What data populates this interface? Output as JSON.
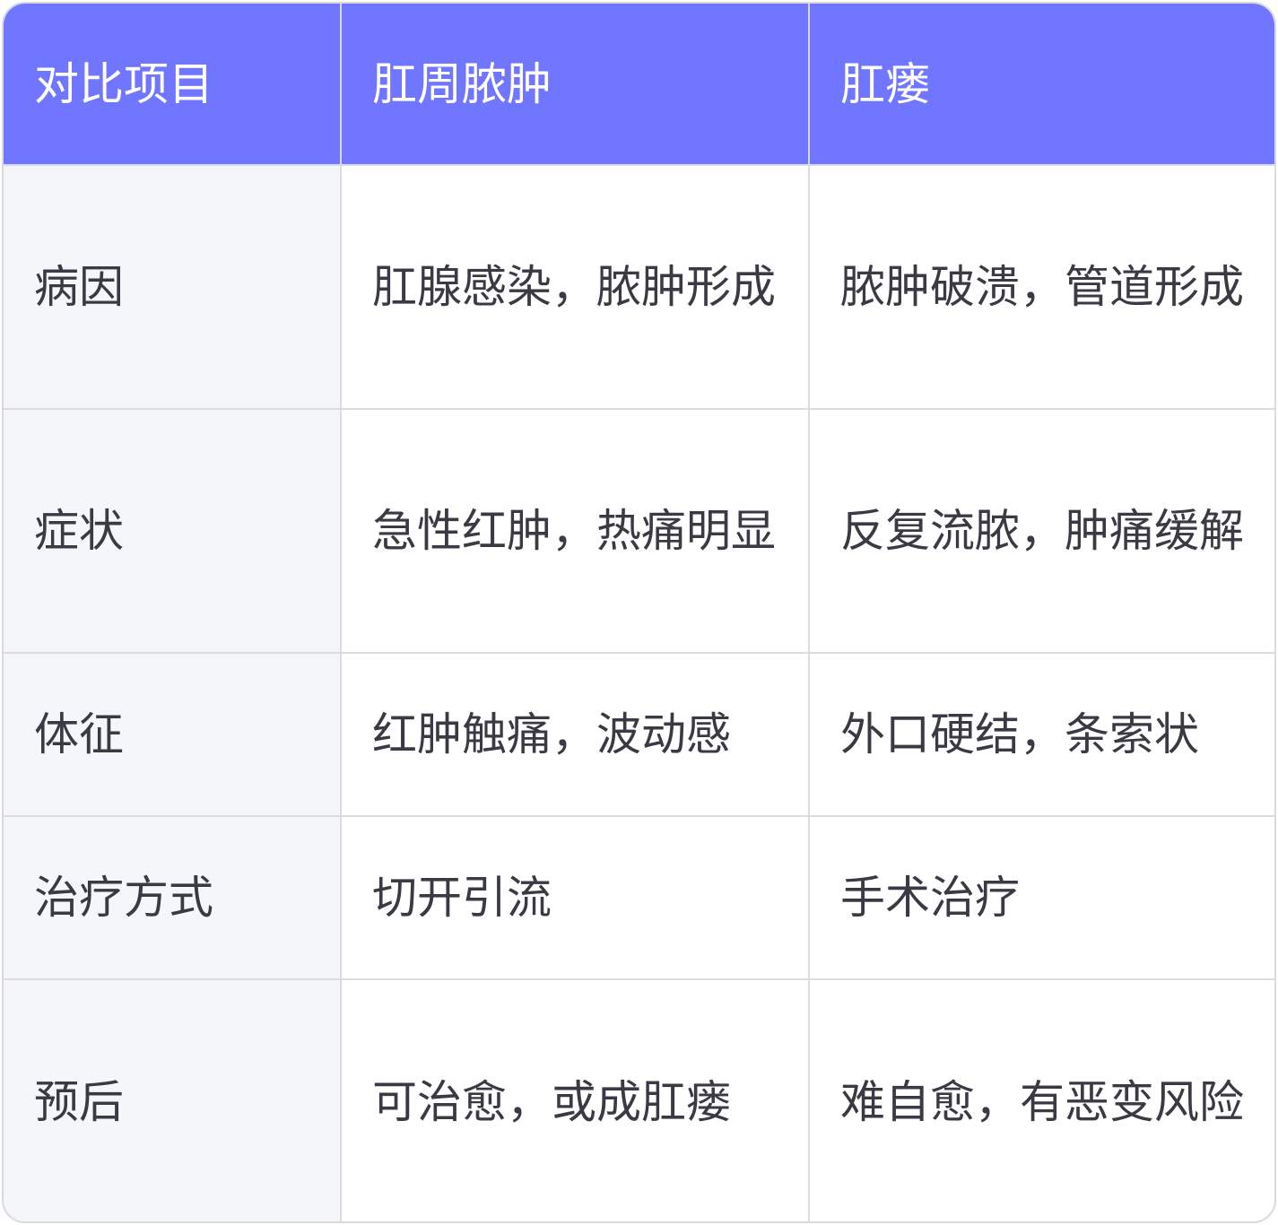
{
  "header": {
    "col1": "对比项目",
    "col2": "肛周脓肿",
    "col3": "肛瘘"
  },
  "rows": [
    {
      "item": "病因",
      "abscess": "肛腺感染，脓肿形成",
      "fistula": "脓肿破溃，管道形成"
    },
    {
      "item": "症状",
      "abscess": "急性红肿，热痛明显",
      "fistula": "反复流脓，肿痛缓解"
    },
    {
      "item": "体征",
      "abscess": "红肿触痛，波动感",
      "fistula": "外口硬结，条索状"
    },
    {
      "item": "治疗方式",
      "abscess": "切开引流",
      "fistula": "手术治疗"
    },
    {
      "item": "预后",
      "abscess": "可治愈，或成肛瘘",
      "fistula": "难自愈，有恶变风险"
    }
  ],
  "colors": {
    "header_bg": "#7076ff",
    "header_text": "#ffffff",
    "label_bg": "#f5f6fa",
    "body_text": "#3a3a44",
    "border": "#dcdce0"
  }
}
